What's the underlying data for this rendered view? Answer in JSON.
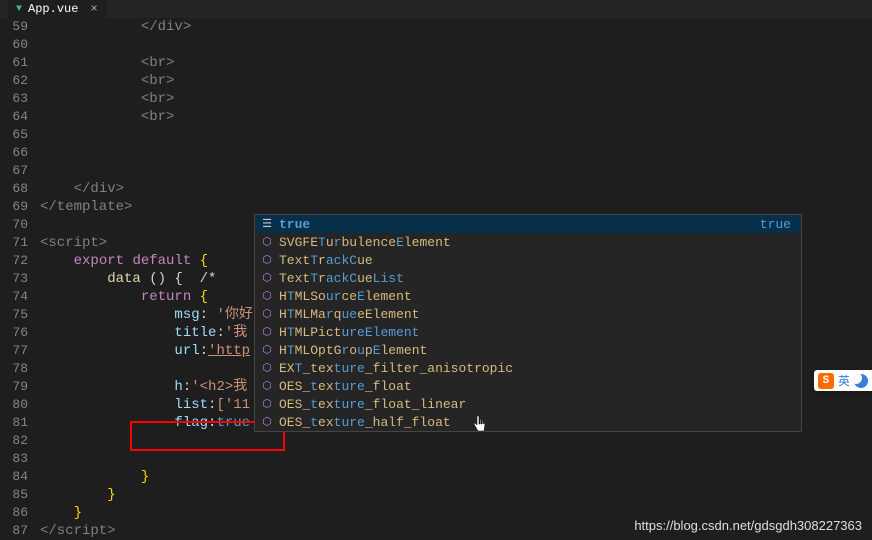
{
  "tab": {
    "filename": "App.vue"
  },
  "lines": {
    "start": 59,
    "end": 87
  },
  "code": {
    "l59": "</div>",
    "l60": "",
    "l61": "<br>",
    "l62": "<br>",
    "l63": "<br>",
    "l64": "<br>",
    "l65": "",
    "l66": "",
    "l67": "",
    "l68": "</div>",
    "l69": "</template>",
    "l70": "",
    "l71": "<script>",
    "l72_export": "export",
    "l72_default": "default",
    "l72_brace": "{",
    "l73_data": "data",
    "l73_rest": " () {  /*",
    "l74_return": "return",
    "l74_brace": " {",
    "l75_key": "msg",
    "l75_val": "'你好",
    "l76_key": "title",
    "l76_val": "'我",
    "l77_key": "url",
    "l77_val": "'http",
    "l78": "",
    "l79_key": "h",
    "l79_val": "'<h2>我",
    "l80_key": "list",
    "l80_val": "['11",
    "l81_key": "flag",
    "l81_val": "true",
    "l82": "",
    "l83": "",
    "l84": "}",
    "l85": "}",
    "l86": "}",
    "l87": "</script>"
  },
  "suggest": {
    "selected": {
      "label": "true",
      "detail": "true"
    },
    "items": [
      {
        "label": "SVGFETurbulenceElement",
        "parts": [
          "SVGFE",
          "T",
          "u",
          "r",
          "bulence",
          "E",
          "lement"
        ]
      },
      {
        "label": "TextTrackCue",
        "parts": [
          "Text",
          "T",
          "r",
          "ackC",
          "ue",
          ""
        ]
      },
      {
        "label": "TextTrackCueList",
        "parts": [
          "Text",
          "T",
          "r",
          "ackC",
          "ue",
          "List"
        ]
      },
      {
        "label": "HTMLSourceElement",
        "parts": [
          "H",
          "T",
          "MLSo",
          "ur",
          "ce",
          "E",
          "lement"
        ]
      },
      {
        "label": "HTMLMarqueeElement",
        "parts": [
          "H",
          "T",
          "MLMa",
          "r",
          "q",
          "ue",
          "eElement"
        ]
      },
      {
        "label": "HTMLPictureElement",
        "parts": [
          "H",
          "T",
          "MLPict",
          "ure",
          "",
          "Element"
        ]
      },
      {
        "label": "HTMLOptGroupElement",
        "parts": [
          "H",
          "T",
          "MLOptG",
          "r",
          "o",
          "u",
          "p",
          "E",
          "lement"
        ]
      },
      {
        "label": "EXT_texture_filter_anisotropic",
        "parts": [
          "EX",
          "T",
          "_tex",
          "t",
          "",
          "ure",
          "_filter_anisotropic"
        ]
      },
      {
        "label": "OES_texture_float",
        "parts": [
          "OES_",
          "t",
          "ex",
          "t",
          "",
          "ure",
          "_float"
        ]
      },
      {
        "label": "OES_texture_float_linear",
        "parts": [
          "OES_",
          "t",
          "ex",
          "t",
          "",
          "ure",
          "_float_linear"
        ]
      },
      {
        "label": "OES_texture_half_float",
        "parts": [
          "OES_",
          "t",
          "ex",
          "t",
          "",
          "ure",
          "_half_float"
        ]
      }
    ]
  },
  "ime": {
    "s": "S",
    "lang": "英"
  },
  "watermark": "https://blog.csdn.net/gdsgdh308227363"
}
